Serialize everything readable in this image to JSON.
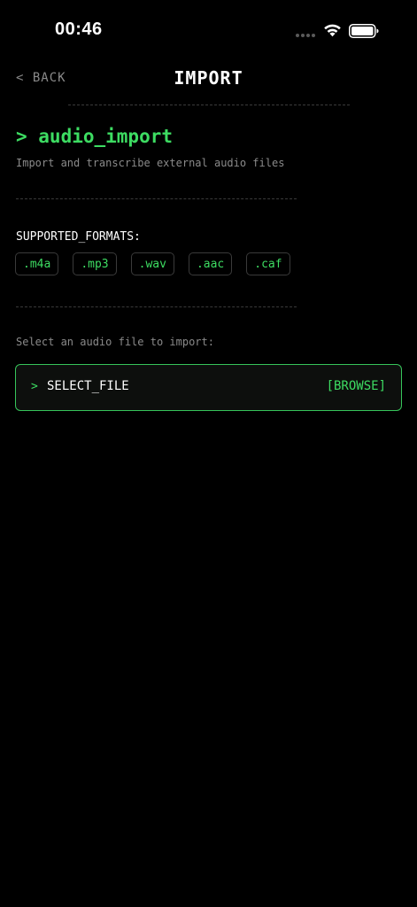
{
  "status_bar": {
    "time": "00:46"
  },
  "nav": {
    "back_label": "< BACK",
    "title": "IMPORT"
  },
  "section": {
    "title": "> audio_import",
    "subtitle": "Import and transcribe external audio files"
  },
  "formats": {
    "label": "SUPPORTED_FORMATS:",
    "items": [
      ".m4a",
      ".mp3",
      ".wav",
      ".aac",
      ".caf"
    ]
  },
  "select": {
    "prompt": "Select an audio file to import:",
    "caret": ">",
    "label": "SELECT_FILE",
    "action": "[BROWSE]"
  },
  "colors": {
    "background": "#000000",
    "accent": "#3ddc62",
    "muted_text": "#8a8a8a",
    "border": "#3a3a3a"
  },
  "icons": {
    "wifi": "wifi-icon",
    "battery": "battery-icon",
    "signal": "signal-dots-icon"
  }
}
